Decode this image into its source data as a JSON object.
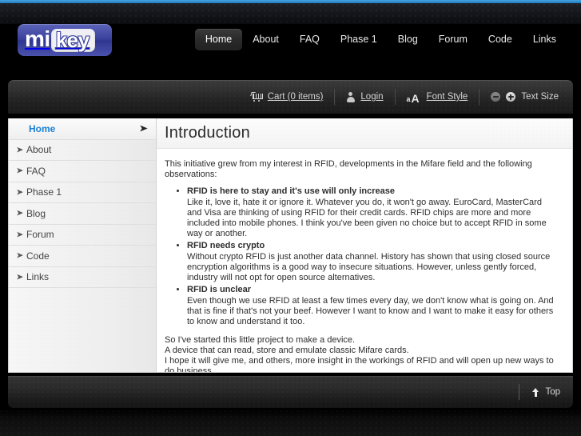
{
  "site": {
    "logo_primary": "mi",
    "logo_secondary": "key"
  },
  "nav": {
    "items": [
      {
        "label": "Home",
        "active": true
      },
      {
        "label": "About",
        "active": false
      },
      {
        "label": "FAQ",
        "active": false
      },
      {
        "label": "Phase 1",
        "active": false
      },
      {
        "label": "Blog",
        "active": false
      },
      {
        "label": "Forum",
        "active": false
      },
      {
        "label": "Code",
        "active": false
      },
      {
        "label": "Links",
        "active": false
      }
    ]
  },
  "toolbar": {
    "cart_prefix": "Cart (",
    "cart_count": "0",
    "cart_suffix": " items)",
    "cart_full": "Cart (0 items)",
    "login_label": "Login",
    "font_style_label": "Font Style",
    "text_size_label": "Text Size",
    "text_size_decrease": "−",
    "text_size_increase": "+"
  },
  "sidebar": {
    "items": [
      {
        "label": "Home",
        "active": true
      },
      {
        "label": "About",
        "active": false
      },
      {
        "label": "FAQ",
        "active": false
      },
      {
        "label": "Phase 1",
        "active": false
      },
      {
        "label": "Blog",
        "active": false
      },
      {
        "label": "Forum",
        "active": false
      },
      {
        "label": "Code",
        "active": false
      },
      {
        "label": "Links",
        "active": false
      }
    ]
  },
  "article": {
    "title": "Introduction",
    "intro": "This initiative grew from my interest in RFID, developments in the Mifare field and the following observations:",
    "observations": [
      {
        "title": "RFID is here to stay and it's use will only increase",
        "text": "Like it, love it, hate it or ignore it. Whatever you do, it won't go away. EuroCard, MasterCard and Visa are thinking of using RFID for their credit cards. RFID chips are more and more included into mobile phones. I think you've been given no choice but to accept RFID in some way or another."
      },
      {
        "title": "RFID needs crypto",
        "text": "Without crypto RFID is just another data channel. History has shown that using closed source encryption algorithms is a good way to insecure situations. However, unless gently forced, industry will not opt for open source alternatives."
      },
      {
        "title": "RFID is unclear",
        "text": "Even though we use RFID at least a few times every day, we don't know what is going on. And that is fine if that's not your beef. However I want to know and I want to make it easy for others to know and understand it too."
      }
    ],
    "closing_lines": [
      "So I've started this little project to make a device.",
      "A device that can read, store and emulate classic Mifare cards.",
      "I hope it will give me, and others, more insight in the workings of RFID and will open up new ways to do business."
    ]
  },
  "footer": {
    "top_label": "Top"
  },
  "colors": {
    "accent_blue": "#2a8ed4",
    "logo_blue": "#39409c",
    "active_link": "#1c7fd4",
    "page_background": "#000000",
    "content_background": "#ffffff",
    "sidebar_background": "#eeeeee"
  }
}
